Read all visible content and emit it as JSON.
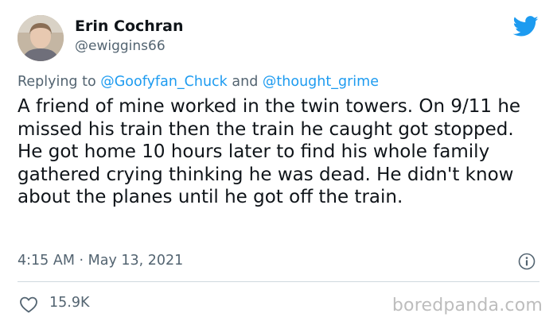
{
  "tweet": {
    "author": {
      "display_name": "Erin Cochran",
      "handle": "@ewiggins66",
      "avatar_icon": "user-avatar"
    },
    "platform_icon": "twitter-bird-icon",
    "reply": {
      "prefix": "Replying to",
      "mention_1": "@Goofyfan_Chuck",
      "conjunction": "and",
      "mention_2": "@thought_grime"
    },
    "text": "A friend of mine worked in the twin towers. On 9/11 he missed his train then the train he caught got stopped. He got home 10 hours later to find his whole family gathered crying thinking he was dead. He didn't know about the planes until he got off the train.",
    "timestamp": "4:15 AM · May 13, 2021",
    "info_icon": "info-icon",
    "like_icon": "heart-icon",
    "likes": "15.9K"
  },
  "watermark": "boredpanda.com",
  "colors": {
    "text_primary": "#0f1419",
    "text_secondary": "#536471",
    "accent": "#1d9bf0",
    "divider": "#cfd9de",
    "watermark": "#bdbdbd"
  }
}
